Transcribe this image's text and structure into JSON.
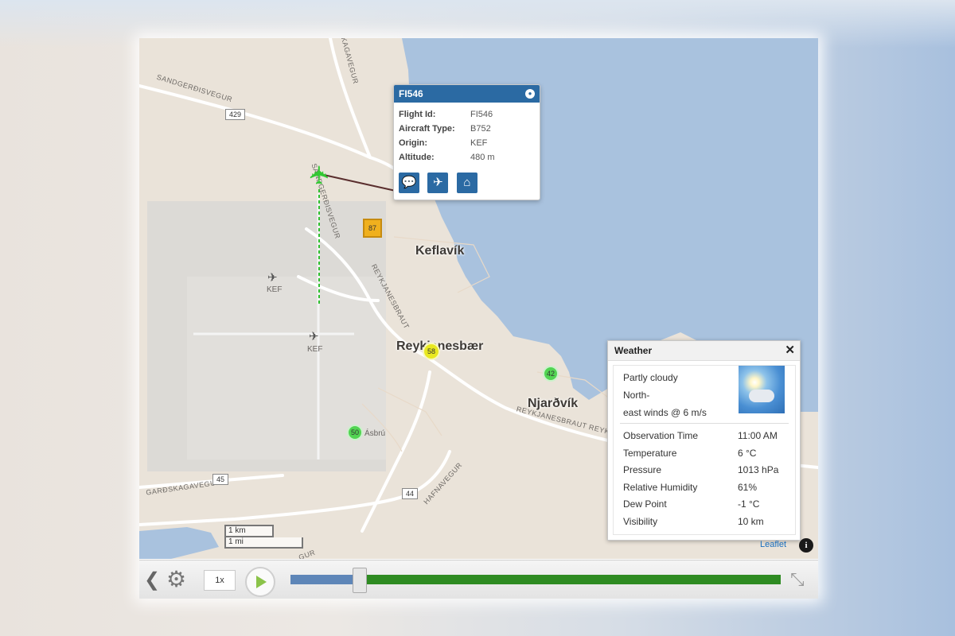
{
  "map": {
    "road_labels": [
      "SANDGERÐISVEGUR",
      "SKAGAVEGUR",
      "SANDGERÐISVEGUR",
      "REYKJANESBRAUT",
      "REYKJANESBRAUT REYKJAN",
      "GARÐSKAGAVEGUR",
      "HAFNAVEGUR",
      "ÐSKAGAVEGUR",
      "GUR"
    ],
    "route_shields": [
      "429",
      "45",
      "44"
    ],
    "cities": [
      "Keflavík",
      "Reykjanesbær",
      "Njarðvík"
    ],
    "place_labels": [
      "Ásbrú"
    ],
    "airport_labels": [
      "KEF",
      "KEF"
    ],
    "clusters": [
      {
        "label": "87",
        "color": "#f0b01e"
      },
      {
        "label": "58",
        "color": "#e8e820"
      },
      {
        "label": "42",
        "color": "#52d452"
      },
      {
        "label": "50",
        "color": "#52d452"
      }
    ],
    "scale": {
      "km": "1 km",
      "mi": "1 mi"
    },
    "attribution": "Leaflet",
    "info_icon": "i",
    "aircraft_icon": "plane-icon",
    "track_color": "#2fbf2f"
  },
  "popup": {
    "title": "FI546",
    "close_icon": "close-circle-icon",
    "fields": [
      {
        "key": "Flight Id:",
        "value": "FI546"
      },
      {
        "key": "Aircraft Type:",
        "value": "B752"
      },
      {
        "key": "Origin:",
        "value": "KEF"
      },
      {
        "key": "Altitude:",
        "value": "480 m"
      }
    ],
    "buttons": [
      {
        "icon": "speech-bubble-icon",
        "glyph": "💬"
      },
      {
        "icon": "airplane-icon",
        "glyph": "✈"
      },
      {
        "icon": "home-icon",
        "glyph": "⌂"
      }
    ]
  },
  "weather": {
    "title": "Weather",
    "close": "✕",
    "description": [
      "Partly cloudy",
      "North-",
      "east winds @ 6 m/s"
    ],
    "icon": "partly-sunny-icon",
    "rows": [
      {
        "key": "Observation Time",
        "value": "11:00 AM"
      },
      {
        "key": "Temperature",
        "value": "6 °C"
      },
      {
        "key": "Pressure",
        "value": "1013 hPa"
      },
      {
        "key": "Relative Humidity",
        "value": "61%"
      },
      {
        "key": "Dew Point",
        "value": "-1 °C"
      },
      {
        "key": "Visibility",
        "value": "10 km"
      }
    ]
  },
  "controls": {
    "back_icon": "chevron-left-icon",
    "settings_icon": "gear-icon",
    "speed": "1x",
    "play_icon": "play-icon",
    "progress": 0.14,
    "fullscreen_icon": "expand-icon"
  }
}
